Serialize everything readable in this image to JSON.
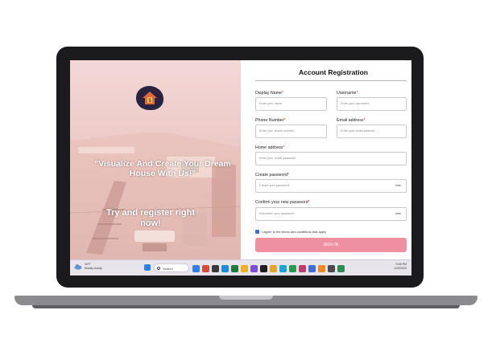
{
  "brand": {
    "promo_heading": "\"Visualize And Create Your Dream House With Us!\"",
    "promo_cta": "Try and register right now!"
  },
  "form": {
    "title": "Account Registration",
    "display_name": {
      "label": "Display Name",
      "placeholder": "Enter your name"
    },
    "username": {
      "label": "Username",
      "placeholder": "Enter your username"
    },
    "phone": {
      "label": "Phone Number",
      "placeholder": "Enter your phone number"
    },
    "email": {
      "label": "Email address",
      "placeholder": "Enter your email address"
    },
    "home": {
      "label": "Home address",
      "placeholder": "Enter your home password"
    },
    "password": {
      "label": "Create password",
      "placeholder": "Create your password",
      "toggle": "hide"
    },
    "confirm": {
      "label": "Confirm your new password",
      "placeholder": "Reconfirm your password",
      "toggle": "hide"
    },
    "required_mark": "*",
    "agree_text": "I agree to the terms and conditions that apply",
    "agree_checked": true,
    "submit_label": "SIGN IN"
  },
  "taskbar": {
    "weather_temp": "34°F",
    "weather_desc": "Mostly cloudy",
    "search_label": "Search",
    "time": "9:46 PM",
    "date": "11/9/2023",
    "icon_colors": [
      "#2f80ed",
      "#d94a3a",
      "#3a3a3a",
      "#1d8be0",
      "#1e7a3c",
      "#f2b01e",
      "#7b4fd6",
      "#1e1e1e",
      "#e0a72b",
      "#19a3d8",
      "#2b9a4a",
      "#c23b6b",
      "#3d6fd6",
      "#f08a24",
      "#4a4a4a",
      "#2e8b57",
      "#8a3fd1",
      "#d8432e"
    ]
  },
  "colors": {
    "accent": "#ee8fa2",
    "checkbox": "#3a6fd8",
    "promo_bg": "#ecc9c5"
  }
}
